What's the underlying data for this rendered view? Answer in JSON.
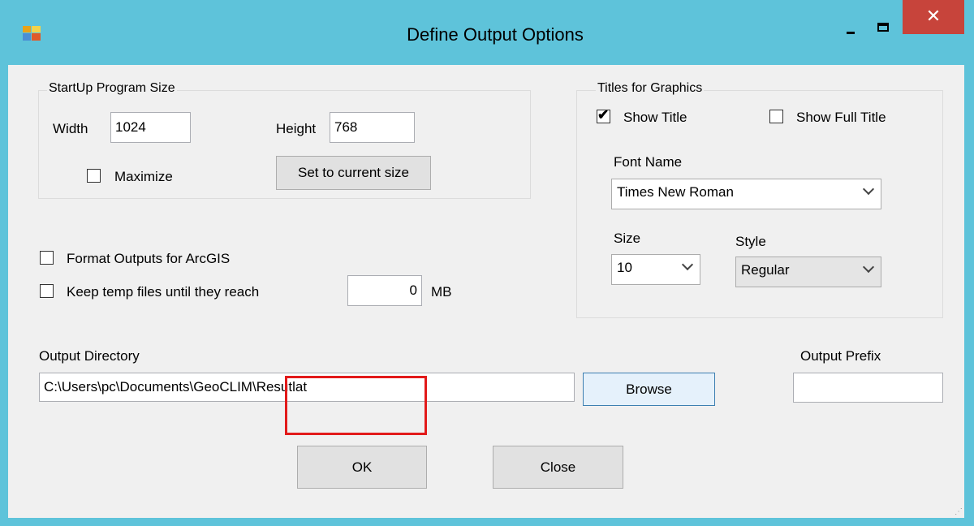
{
  "window": {
    "title": "Define Output Options",
    "close_glyph": "✕"
  },
  "startup": {
    "legend": "StartUp Program Size",
    "width_label": "Width",
    "width_value": "1024",
    "height_label": "Height",
    "height_value": "768",
    "maximize_label": "Maximize",
    "maximize_checked": false,
    "set_current_label": "Set to current size"
  },
  "options": {
    "format_arcgis_label": "Format Outputs for ArcGIS",
    "keep_temp_label": "Keep temp files until they reach",
    "temp_limit_value": "0",
    "temp_unit": "MB"
  },
  "titles": {
    "legend": "Titles for Graphics",
    "show_title_label": "Show Title",
    "show_title_checked": true,
    "show_full_title_label": "Show Full Title",
    "show_full_title_checked": false,
    "font_name_label": "Font Name",
    "font_name_value": "Times New Roman",
    "size_label": "Size",
    "size_value": "10",
    "style_label": "Style",
    "style_value": "Regular"
  },
  "output": {
    "directory_label": "Output Directory",
    "directory_value": "C:\\Users\\pc\\Documents\\GeoCLIM\\Resutlat",
    "browse_label": "Browse",
    "prefix_label": "Output Prefix",
    "prefix_value": ""
  },
  "buttons": {
    "ok_label": "OK",
    "close_label": "Close"
  },
  "colors": {
    "titlebar": "#5ec3da",
    "close_button": "#c7443b",
    "highlight": "#e21a1a"
  },
  "icons": [
    "app-icon",
    "minimize-icon",
    "maximize-icon",
    "close-icon",
    "chevron-down-icon",
    "checkmark-icon"
  ]
}
